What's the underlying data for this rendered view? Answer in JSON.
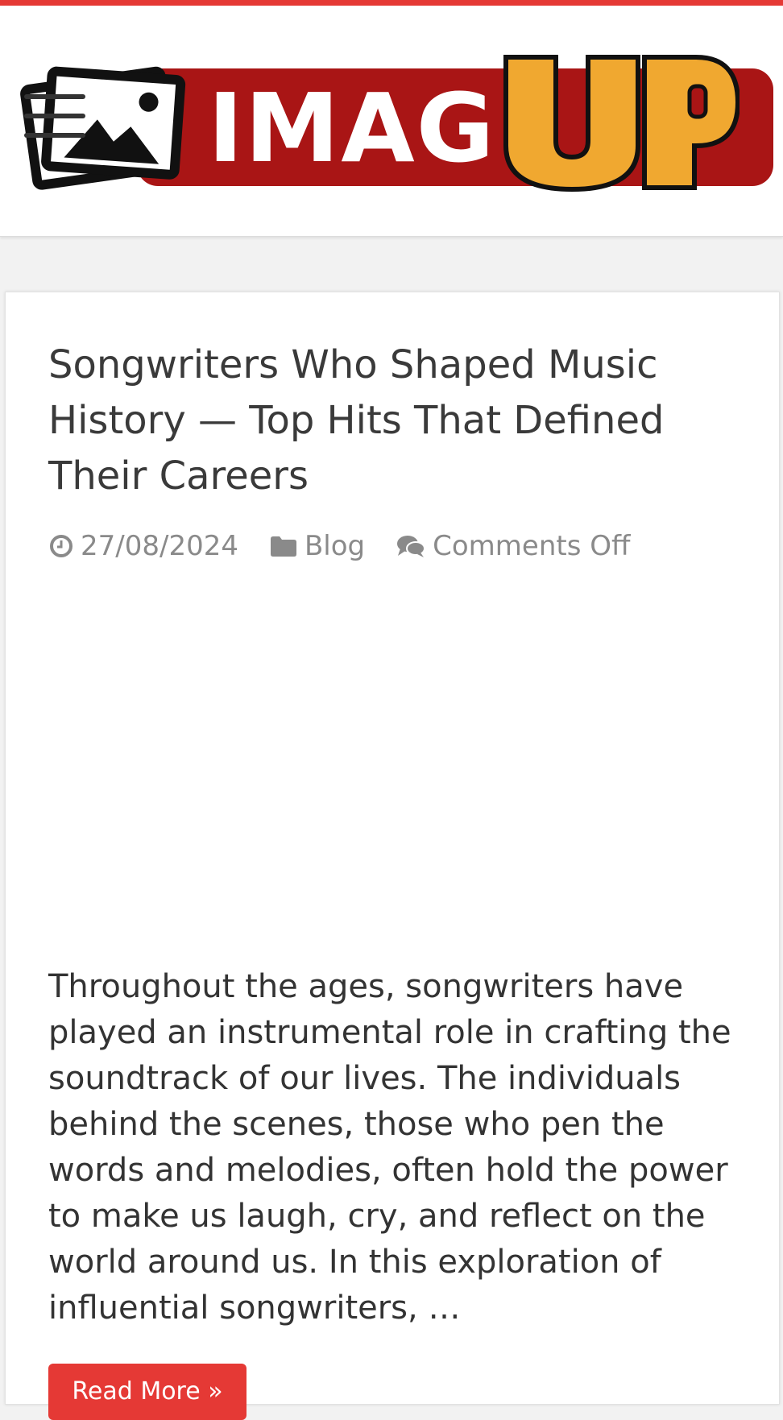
{
  "site": {
    "logo_text": "IMAG",
    "logo_accent": "UP",
    "brand_red": "#e53935",
    "logo_red": "#a91515",
    "logo_orange": "#f0a830"
  },
  "header": {
    "menu_icon": "hamburger-menu-icon"
  },
  "post": {
    "title": "Songwriters Who Shaped Music History — Top Hits That Defined Their Careers",
    "date": "27/08/2024",
    "date_icon": "clock-icon",
    "category": "Blog",
    "category_icon": "folder-icon",
    "comments": "Comments Off",
    "comments_icon": "comments-icon",
    "excerpt": "Throughout the ages, songwriters have played an instrumental role in crafting the soundtrack of our lives. The individuals behind the scenes, those who pen the words and melodies, often hold the power to make us laugh, cry, and reflect on the world around us. In this exploration of influential songwriters, …",
    "read_more": "Read More »"
  }
}
